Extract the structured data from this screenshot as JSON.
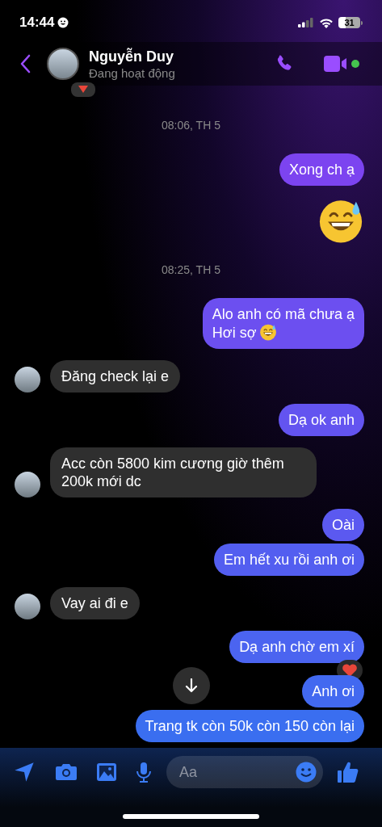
{
  "status_bar": {
    "time": "14:44",
    "battery": "31"
  },
  "header": {
    "name": "Nguyễn Duy",
    "status": "Đang hoạt động",
    "online": true
  },
  "messages": [
    {
      "kind": "timestamp",
      "text": "08:06, TH 5"
    },
    {
      "kind": "outgoing",
      "text": "Xong ch ạ",
      "reaction": false,
      "emoji_after": false
    },
    {
      "kind": "emoji"
    },
    {
      "kind": "timestamp",
      "text": "08:25, TH 5"
    },
    {
      "kind": "outgoing",
      "text": "Alo anh có mã chưa ạ\nHơi sợ",
      "reaction": false,
      "emoji_after": true
    },
    {
      "kind": "incoming",
      "text": "Đăng check lại e"
    },
    {
      "kind": "outgoing",
      "text": "Dạ ok anh",
      "reaction": false,
      "emoji_after": false
    },
    {
      "kind": "incoming",
      "text": "Acc còn 5800 kim cương giờ thêm 200k mới dc"
    },
    {
      "kind": "outgoing",
      "text": "Oài",
      "reaction": false,
      "emoji_after": false
    },
    {
      "kind": "outgoing",
      "text": "Em hết xu rồi anh ơi",
      "reaction": false,
      "emoji_after": false
    },
    {
      "kind": "incoming",
      "text": "Vay ai đi e"
    },
    {
      "kind": "outgoing",
      "text": "Dạ anh chờ em xí",
      "reaction": true,
      "emoji_after": false
    },
    {
      "kind": "outgoing",
      "text": "Anh ơi",
      "reaction": false,
      "emoji_after": false
    },
    {
      "kind": "outgoing",
      "text": "Trang tk còn 50k còn 150 còn lại",
      "reaction": false,
      "emoji_after": false
    }
  ],
  "composer": {
    "placeholder": "Aa"
  }
}
